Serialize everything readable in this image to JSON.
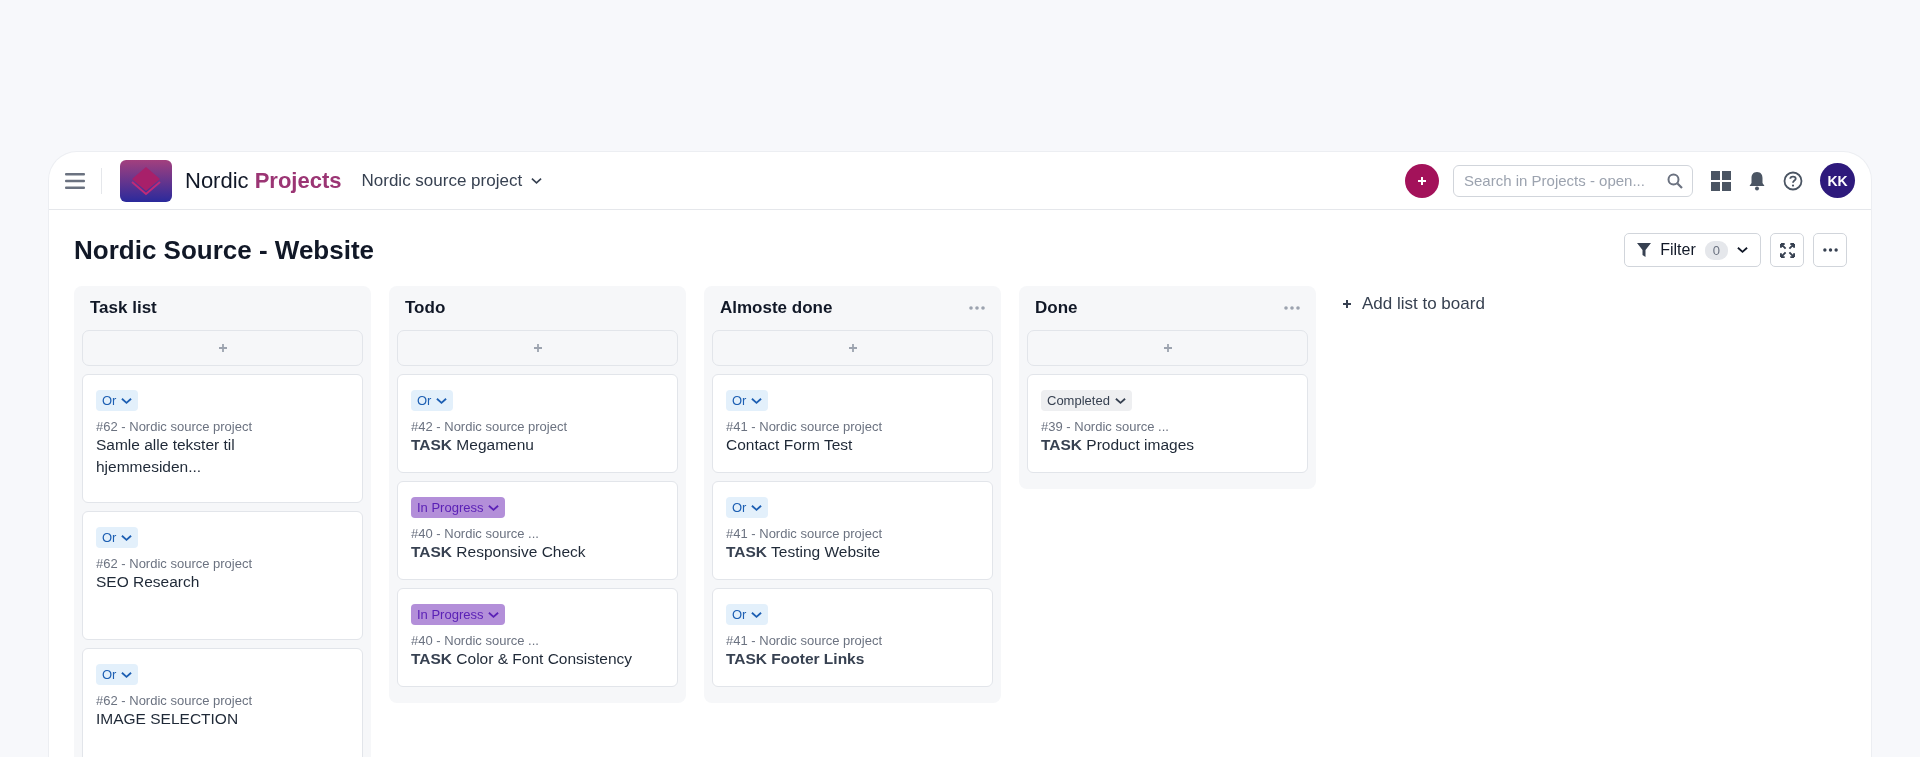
{
  "header": {
    "brand_plain": "Nordic",
    "brand_accent": "Projects",
    "project_selector": "Nordic source project",
    "search": {
      "placeholder": "Search in Projects - open..."
    },
    "avatar": "KK"
  },
  "board": {
    "title": "Nordic Source - Website",
    "filter": {
      "label": "Filter",
      "count": "0"
    },
    "lists": [
      {
        "name": "Task list",
        "has_menu": false,
        "cards": [
          {
            "status": {
              "label": "Or",
              "kind": "or"
            },
            "meta": "#62 - Nordic source project",
            "title": "Samle alle tekster til hjemmesiden...",
            "emphasis": false
          },
          {
            "status": {
              "label": "Or",
              "kind": "or"
            },
            "meta": "#62 - Nordic source project",
            "title": "SEO Research",
            "emphasis": false
          },
          {
            "status": {
              "label": "Or",
              "kind": "or"
            },
            "meta": "#62 - Nordic source project",
            "title": "IMAGE SELECTION",
            "emphasis": false
          }
        ]
      },
      {
        "name": "Todo",
        "has_menu": false,
        "cards": [
          {
            "status": {
              "label": "Or",
              "kind": "or"
            },
            "meta": "#42 - Nordic source project",
            "title": "**TASK** Megamenu",
            "emphasis": false
          },
          {
            "status": {
              "label": "In Progress",
              "kind": "in_progress"
            },
            "meta": "#40 - Nordic source ...",
            "title": "**TASK** Responsive Check",
            "emphasis": false
          },
          {
            "status": {
              "label": "In Progress",
              "kind": "in_progress"
            },
            "meta": "#40 - Nordic source ...",
            "title": "**TASK** Color & Font Consistency",
            "emphasis": false
          }
        ]
      },
      {
        "name": "Almoste done",
        "has_menu": true,
        "cards": [
          {
            "status": {
              "label": "Or",
              "kind": "or"
            },
            "meta": "#41 - Nordic source project",
            "title": "Contact Form Test",
            "emphasis": false
          },
          {
            "status": {
              "label": "Or",
              "kind": "or"
            },
            "meta": "#41 - Nordic source project",
            "title": "**TASK** Testing Website",
            "emphasis": false
          },
          {
            "status": {
              "label": "Or",
              "kind": "or"
            },
            "meta": "#41 - Nordic source project",
            "title": "TASK Footer Links",
            "emphasis": true
          }
        ]
      },
      {
        "name": "Done",
        "has_menu": true,
        "cards": [
          {
            "status": {
              "label": "Completed",
              "kind": "completed"
            },
            "meta": "#39 - Nordic source ...",
            "title": "**TASK** Product images",
            "emphasis": false
          }
        ]
      }
    ],
    "add_list": "Add list to board"
  }
}
